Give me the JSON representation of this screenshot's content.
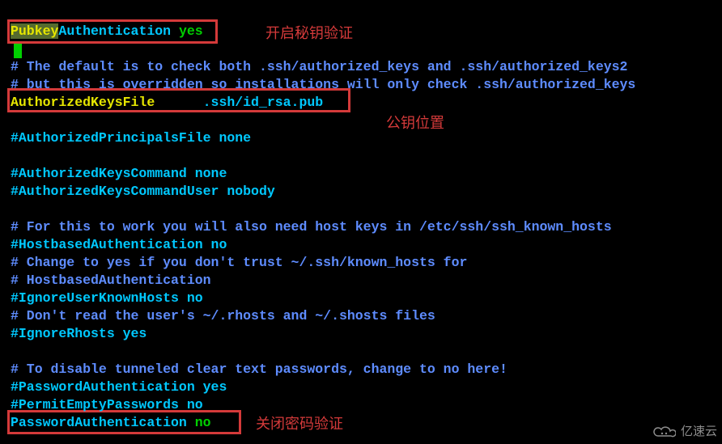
{
  "lines": {
    "l01a": "Pubkey",
    "l01b": "Authentication ",
    "l01c": "yes",
    "l03": "# The default is to check both .ssh/authorized_keys and .ssh/authorized_keys2",
    "l04": "# but this is overridden so installations will only check .ssh/authorized_keys",
    "l05a": "AuthorizedKeysFile",
    "l05b": "      .ssh/id_rsa.pub",
    "l07": "#AuthorizedPrincipalsFile none",
    "l09": "#AuthorizedKeysCommand none",
    "l10": "#AuthorizedKeysCommandUser nobody",
    "l12": "# For this to work you will also need host keys in /etc/ssh/ssh_known_hosts",
    "l13": "#HostbasedAuthentication no",
    "l14": "# Change to yes if you don't trust ~/.ssh/known_hosts for",
    "l15": "# HostbasedAuthentication",
    "l16": "#IgnoreUserKnownHosts no",
    "l17": "# Don't read the user's ~/.rhosts and ~/.shosts files",
    "l18": "#IgnoreRhosts yes",
    "l20": "# To disable tunneled clear text passwords, change to no here!",
    "l21": "#PasswordAuthentication yes",
    "l22": "#PermitEmptyPasswords no",
    "l23a": "PasswordAuthentication ",
    "l23b": "no"
  },
  "annotations": {
    "a1": "开启秘钥验证",
    "a2": "公钥位置",
    "a3": "关闭密码验证"
  },
  "watermark": {
    "text": "亿速云"
  }
}
